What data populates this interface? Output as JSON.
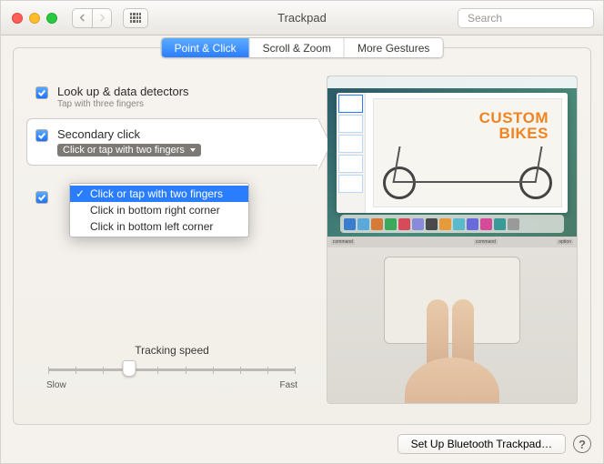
{
  "toolbar": {
    "title": "Trackpad",
    "search_placeholder": "Search"
  },
  "tabs": {
    "point_click": "Point & Click",
    "scroll_zoom": "Scroll & Zoom",
    "more_gestures": "More Gestures"
  },
  "options": {
    "lookup": {
      "title": "Look up & data detectors",
      "sub": "Tap with three fingers"
    },
    "secondary": {
      "title": "Secondary click",
      "selected": "Click or tap with two fingers"
    },
    "dropdown": {
      "item1": "Click or tap with two fingers",
      "item2": "Click in bottom right corner",
      "item3": "Click in bottom left corner"
    }
  },
  "slider": {
    "label": "Tracking speed",
    "slow": "Slow",
    "fast": "Fast"
  },
  "preview": {
    "headline1": "CUSTOM",
    "headline2": "BIKES",
    "key_cmd": "command",
    "key_opt": "option"
  },
  "footer": {
    "setup": "Set Up Bluetooth Trackpad…"
  }
}
